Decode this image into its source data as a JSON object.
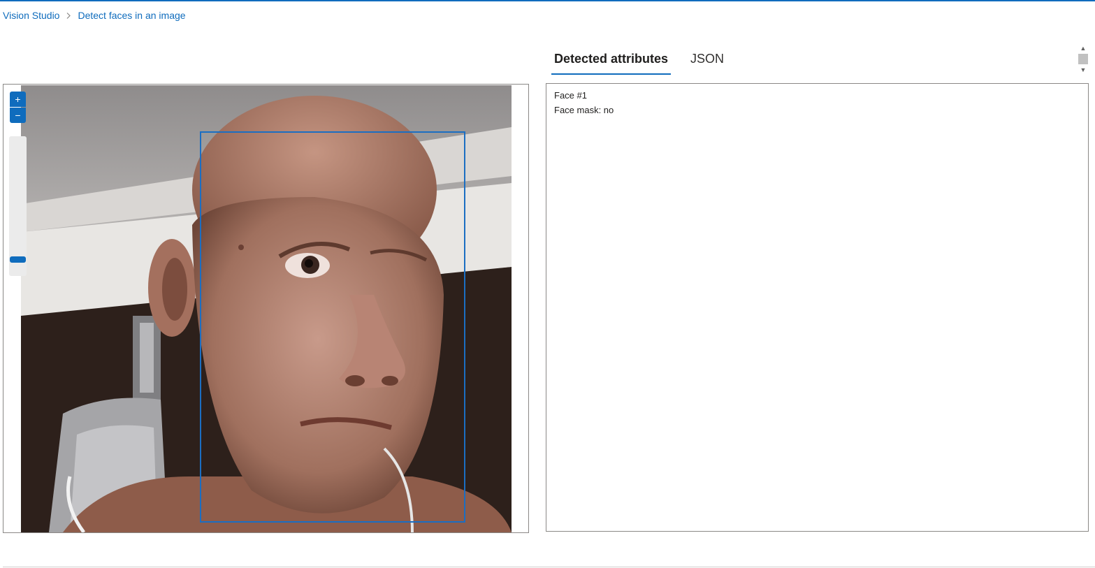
{
  "breadcrumb": {
    "root": "Vision Studio",
    "separator_icon": "chevron-right-icon",
    "current": "Detect faces in an image"
  },
  "viewer": {
    "zoom_in_icon": "plus-icon",
    "zoom_out_icon": "minus-icon",
    "zoom_level_fraction": 0.9,
    "image_description_icon": "photo-of-bald-man",
    "face_box_color": "#1b6ec2"
  },
  "tabs": [
    {
      "label": "Detected attributes",
      "active": true
    },
    {
      "label": "JSON",
      "active": false
    }
  ],
  "results": {
    "face_title": "Face #1",
    "face_mask": "Face mask: no"
  },
  "colors": {
    "accent": "#0f6cbd",
    "border": "#8a8886"
  }
}
